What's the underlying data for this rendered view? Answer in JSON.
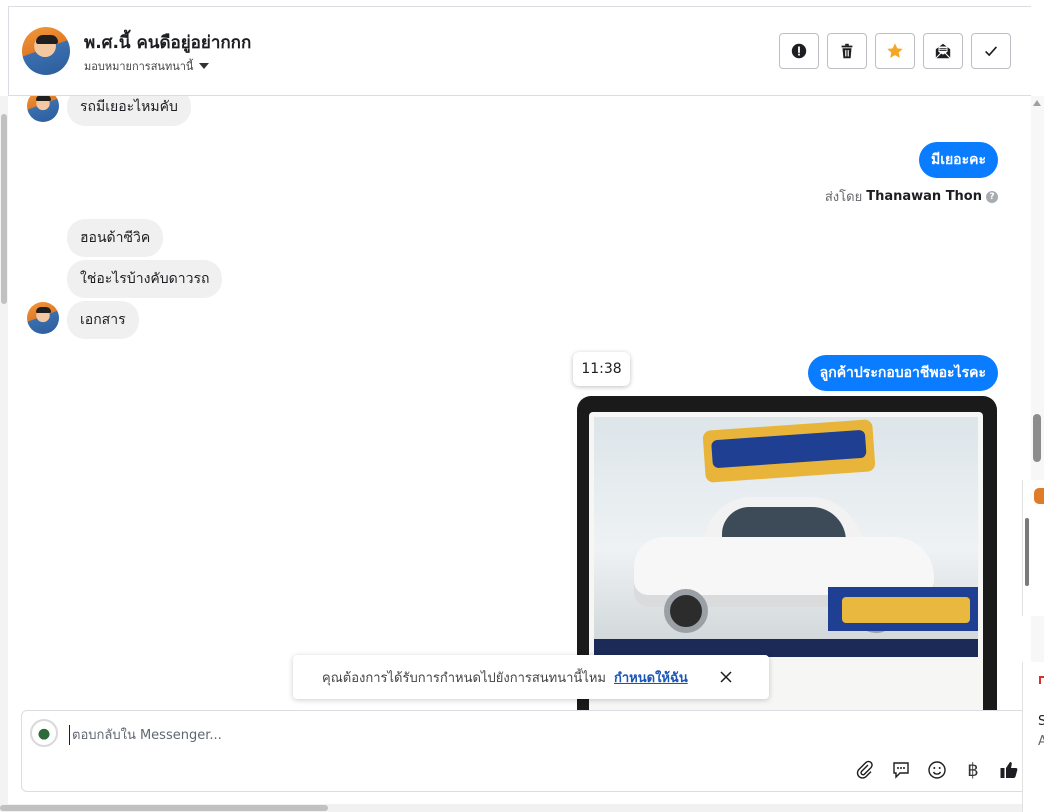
{
  "header": {
    "contact_name": "พ.ศ.นี้ คนดือยู่อย่ากกก",
    "assign_label": "มอบหมายการสนทนานี้"
  },
  "header_actions": [
    {
      "name": "spam-button",
      "icon": "alert-circle-icon"
    },
    {
      "name": "delete-button",
      "icon": "trash-icon"
    },
    {
      "name": "star-button",
      "icon": "star-icon",
      "color": "#f5a623"
    },
    {
      "name": "mark-unread-button",
      "icon": "envelope-open-icon"
    },
    {
      "name": "mark-done-button",
      "icon": "check-icon"
    }
  ],
  "messages": {
    "m1": "รถมีเยอะไหมคับ",
    "m2": "มีเยอะคะ",
    "sent_by_prefix": "ส่งโดย",
    "sent_by_name": "Thanawan Thon",
    "m3": "ฮอนด้าซีวิค",
    "m4": "ใช่อะไรบ้างคับดาวรถ",
    "m5": "เอกสาร",
    "m6": "ลูกค้าประกอบอาชีพอะไรคะ",
    "time_chip": "11:38"
  },
  "toast": {
    "text": "คุณต้องการได้รับการกำหนดไปยังการสนทนานี้ไหม",
    "link": "กำหนดให้ฉัน"
  },
  "composer": {
    "placeholder": "ตอบกลับใน Messenger...",
    "baht_symbol": "฿"
  },
  "colors": {
    "outgoing_bubble": "#0a7cff",
    "incoming_bubble": "#f0f0f0",
    "link": "#1a56b8"
  },
  "edge": {
    "s1": "S",
    "s2": "A"
  }
}
